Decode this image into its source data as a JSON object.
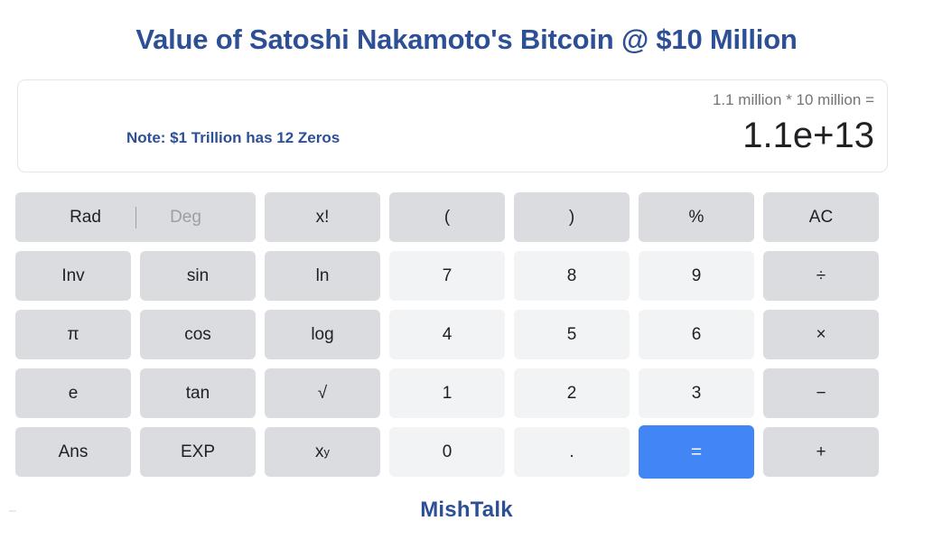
{
  "page": {
    "title": "Value of Satoshi Nakamoto's Bitcoin @ $10 Million",
    "footer_brand": "MishTalk",
    "accent_color": "#2d4f96",
    "equals_color": "#4285f4",
    "function_key_color": "#dadce0",
    "number_key_color": "#f1f3f4"
  },
  "display": {
    "note": "Note: $1 Trillion has 12 Zeros",
    "expression": "1.1 million * 10 million =",
    "result": "1.1e+13"
  },
  "keypad": {
    "angle_mode": {
      "rad_label": "Rad",
      "deg_label": "Deg",
      "active": "Rad"
    },
    "rows": [
      [
        {
          "label": "Rad|Deg",
          "type": "toggle"
        },
        {
          "label": "x!",
          "type": "function"
        },
        {
          "label": "(",
          "type": "function"
        },
        {
          "label": ")",
          "type": "function"
        },
        {
          "label": "%",
          "type": "function"
        },
        {
          "label": "AC",
          "type": "function"
        }
      ],
      [
        {
          "label": "Inv",
          "type": "function"
        },
        {
          "label": "sin",
          "type": "function"
        },
        {
          "label": "ln",
          "type": "function"
        },
        {
          "label": "7",
          "type": "number"
        },
        {
          "label": "8",
          "type": "number"
        },
        {
          "label": "9",
          "type": "number"
        },
        {
          "label": "÷",
          "type": "function"
        }
      ],
      [
        {
          "label": "π",
          "type": "function"
        },
        {
          "label": "cos",
          "type": "function"
        },
        {
          "label": "log",
          "type": "function"
        },
        {
          "label": "4",
          "type": "number"
        },
        {
          "label": "5",
          "type": "number"
        },
        {
          "label": "6",
          "type": "number"
        },
        {
          "label": "×",
          "type": "function"
        }
      ],
      [
        {
          "label": "e",
          "type": "function"
        },
        {
          "label": "tan",
          "type": "function"
        },
        {
          "label": "√",
          "type": "function"
        },
        {
          "label": "1",
          "type": "number"
        },
        {
          "label": "2",
          "type": "number"
        },
        {
          "label": "3",
          "type": "number"
        },
        {
          "label": "−",
          "type": "function"
        }
      ],
      [
        {
          "label": "Ans",
          "type": "function"
        },
        {
          "label": "EXP",
          "type": "function"
        },
        {
          "label": "x^y",
          "type": "power"
        },
        {
          "label": "0",
          "type": "number"
        },
        {
          "label": ".",
          "type": "number"
        },
        {
          "label": "=",
          "type": "equals"
        },
        {
          "label": "+",
          "type": "function"
        }
      ]
    ],
    "power_key": {
      "base": "x",
      "exponent": "y"
    }
  }
}
